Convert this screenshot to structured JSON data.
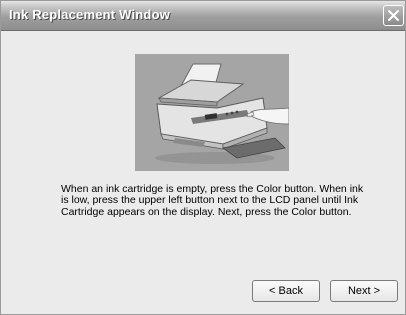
{
  "window": {
    "title": "Ink Replacement Window"
  },
  "illustration": {
    "icon": "printer-illustration"
  },
  "message": {
    "text": "When an ink cartridge is empty, press the Color button. When ink is low, press the upper left button next to the LCD panel until Ink Cartridge appears on the display. Next, press the Color button."
  },
  "buttons": {
    "back_label": "< Back",
    "next_label": "Next >"
  }
}
